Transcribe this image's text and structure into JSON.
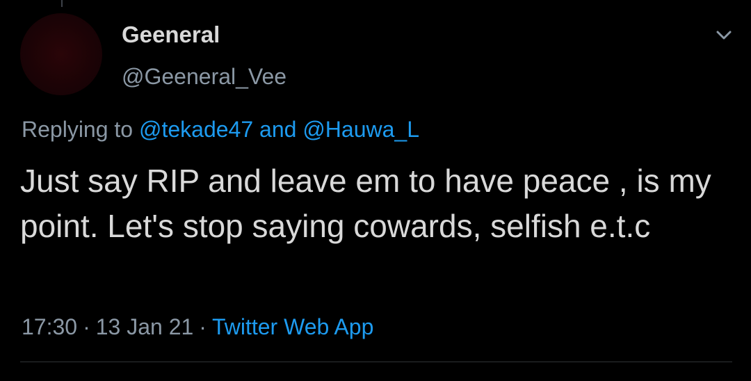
{
  "tweet": {
    "display_name": "Geeneral",
    "handle": "@Geeneral_Vee",
    "replying_prefix": "Replying to",
    "reply_mentions": [
      "@tekade47",
      "@Hauwa_L"
    ],
    "reply_conjunction": "and",
    "text": "Just say RIP and leave em to have peace , is my point. Let's stop saying cowards, selfish e.t.c",
    "time": "17:30",
    "date": "13 Jan 21",
    "separator": "·",
    "source": "Twitter Web App",
    "more_icon": "chevron-down-icon"
  },
  "colors": {
    "background": "#000000",
    "primary_text": "#d9d9d9",
    "secondary_text": "#8b98a5",
    "link": "#1d9bf0",
    "divider": "#2f3336",
    "avatar": "#1c0306"
  }
}
